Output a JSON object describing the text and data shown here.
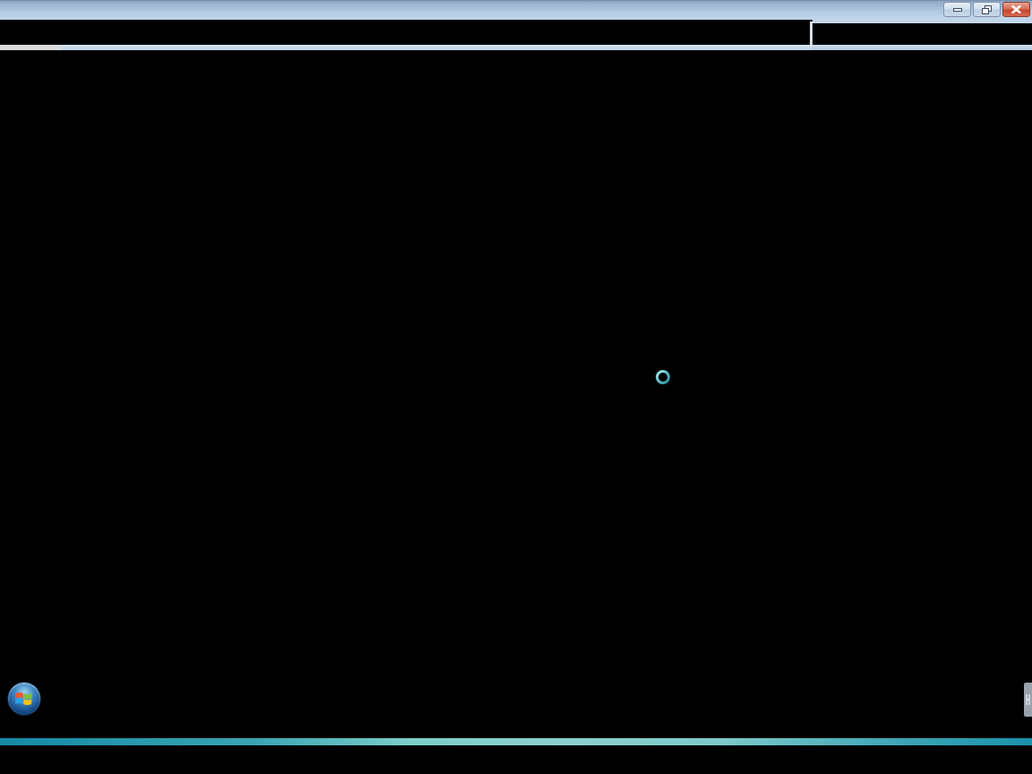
{
  "window": {
    "controls": [
      {
        "kind": "minimize"
      },
      {
        "kind": "restore"
      },
      {
        "kind": "close"
      }
    ]
  },
  "content": {
    "loading": true
  }
}
